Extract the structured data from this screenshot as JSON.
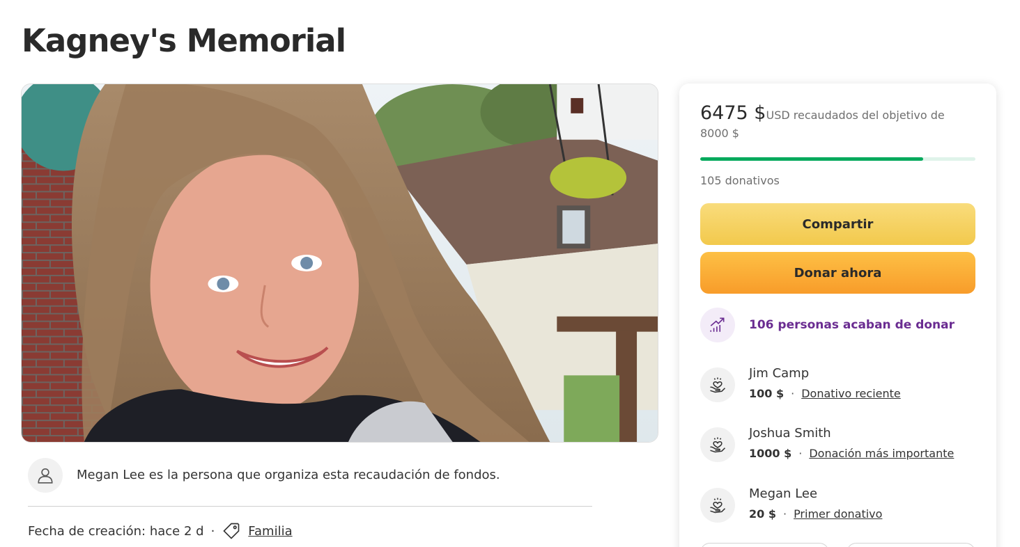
{
  "page": {
    "title": "Kagney's Memorial"
  },
  "organizer": {
    "text": "Megan Lee es la persona que organiza esta recaudación de fondos.",
    "icon": "user-icon"
  },
  "meta": {
    "created": "Fecha de creación: hace 2 d",
    "separator": "·",
    "category": "Familia",
    "category_icon": "tag-icon"
  },
  "campaign": {
    "raised": "6475 $",
    "currency_text": "USD recaudados del objetivo de",
    "goal": "8000 $",
    "progress_fraction": 0.809,
    "donation_count": "105 donativos"
  },
  "buttons": {
    "share": "Compartir",
    "donate": "Donar ahora"
  },
  "recent_activity": {
    "text": "106 personas acaban de donar",
    "icon": "trending-up-icon"
  },
  "donors": [
    {
      "name": "Jim Camp",
      "amount": "100 $",
      "label": "Donativo reciente"
    },
    {
      "name": "Joshua Smith",
      "amount": "1000 $",
      "label": "Donación más importante"
    },
    {
      "name": "Megan Lee",
      "amount": "20 $",
      "label": "Primer donativo"
    }
  ],
  "colors": {
    "progress": "#02a95c",
    "progress_track": "#dff3ea",
    "share_button": "#f2c94c",
    "donate_button": "#f89c2a",
    "accent_purple": "#6a2c91"
  }
}
